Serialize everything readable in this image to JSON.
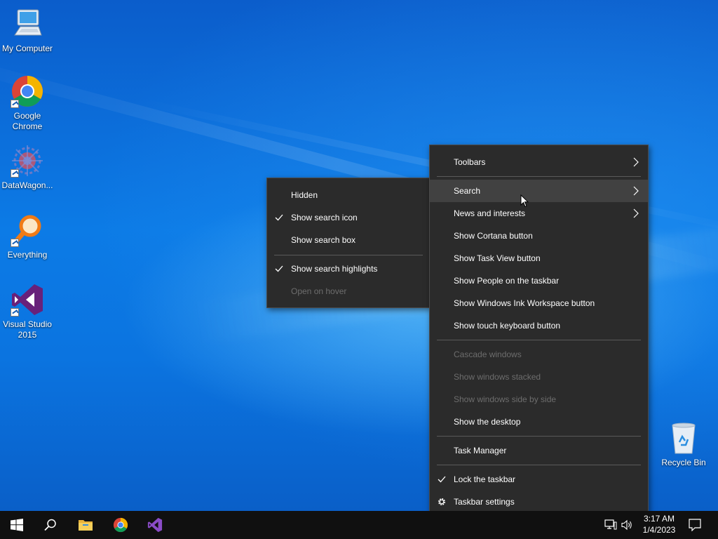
{
  "desktop": {
    "icons": [
      {
        "label": "My Computer"
      },
      {
        "label": "Google Chrome"
      },
      {
        "label": "DataWagon..."
      },
      {
        "label": "Everything"
      },
      {
        "label": "Visual Studio 2015"
      },
      {
        "label": "Recycle Bin"
      }
    ]
  },
  "context_menu": {
    "items": [
      {
        "label": "Toolbars",
        "submenu": true
      },
      {
        "label": "Search",
        "submenu": true,
        "highlighted": true
      },
      {
        "label": "News and interests",
        "submenu": true
      },
      {
        "label": "Show Cortana button"
      },
      {
        "label": "Show Task View button"
      },
      {
        "label": "Show People on the taskbar"
      },
      {
        "label": "Show Windows Ink Workspace button"
      },
      {
        "label": "Show touch keyboard button"
      },
      {
        "label": "Cascade windows",
        "disabled": true
      },
      {
        "label": "Show windows stacked",
        "disabled": true
      },
      {
        "label": "Show windows side by side",
        "disabled": true
      },
      {
        "label": "Show the desktop"
      },
      {
        "label": "Task Manager"
      },
      {
        "label": "Lock the taskbar",
        "checked": true
      },
      {
        "label": "Taskbar settings",
        "icon": "gear-icon"
      }
    ]
  },
  "search_submenu": {
    "items": [
      {
        "label": "Hidden"
      },
      {
        "label": "Show search icon",
        "checked": true
      },
      {
        "label": "Show search box"
      },
      {
        "label": "Show search highlights",
        "checked": true
      },
      {
        "label": "Open on hover",
        "disabled": true
      }
    ]
  },
  "taskbar": {
    "pinned": [
      "start-icon",
      "search-icon",
      "file-explorer-icon",
      "chrome-icon",
      "visual-studio-icon"
    ],
    "tray_icons": [
      "network-icon",
      "volume-icon"
    ],
    "clock": {
      "time": "3:17 AM",
      "date": "1/4/2023"
    },
    "notification_icon": "action-center-icon"
  },
  "colors": {
    "menu_bg": "#2b2b2b",
    "menu_highlight": "#414141",
    "disabled_text": "#6d6d6d",
    "taskbar_bg": "#101010"
  }
}
